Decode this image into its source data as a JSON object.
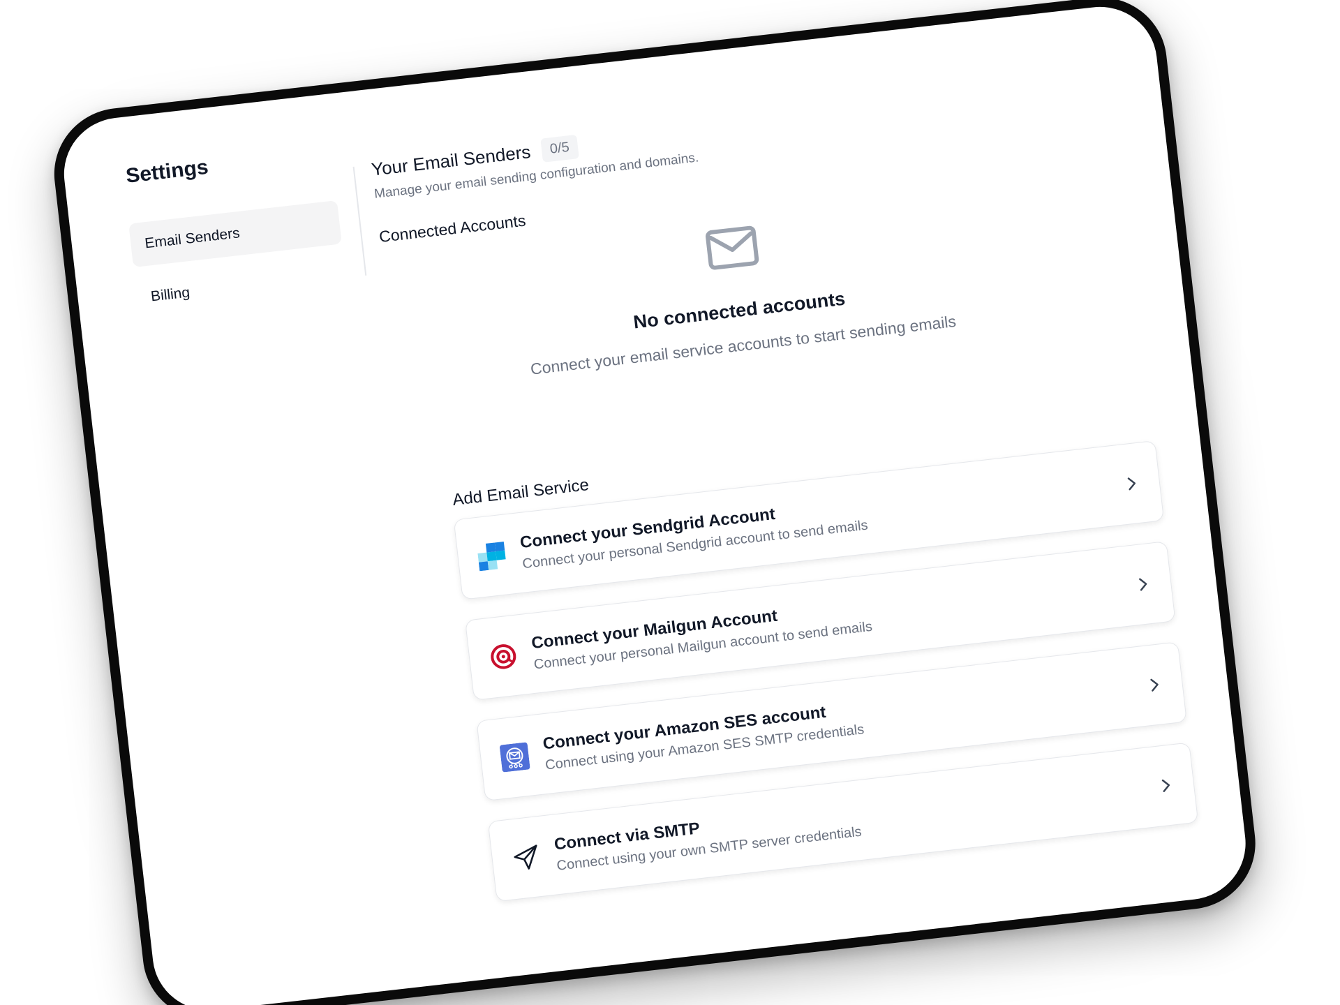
{
  "sidebar": {
    "title": "Settings",
    "items": [
      {
        "label": "Email Senders",
        "active": true
      },
      {
        "label": "Billing",
        "active": false
      }
    ]
  },
  "header": {
    "title": "Your Email Senders",
    "count": "0/5",
    "subtitle": "Manage your email sending configuration and domains."
  },
  "connected": {
    "title": "Connected Accounts",
    "empty_icon": "mail-icon",
    "empty_title": "No connected accounts",
    "empty_subtitle": "Connect your email service accounts to start sending emails"
  },
  "add_service": {
    "title": "Add Email Service",
    "services": [
      {
        "title": "Connect your Sendgrid Account",
        "description": "Connect your personal Sendgrid account to send emails",
        "icon": "sendgrid-icon"
      },
      {
        "title": "Connect your Mailgun Account",
        "description": "Connect your personal Mailgun account to send emails",
        "icon": "mailgun-icon"
      },
      {
        "title": "Connect your Amazon SES account",
        "description": "Connect using your Amazon SES SMTP credentials",
        "icon": "amazon-ses-icon"
      },
      {
        "title": "Connect via SMTP",
        "description": "Connect using your own SMTP server credentials",
        "icon": "paper-plane-icon"
      }
    ]
  },
  "colors": {
    "text_primary": "#111827",
    "text_muted": "#6b7280",
    "active_nav_bg": "#f4f4f5",
    "mailgun_red": "#c8102e",
    "ses_blue": "#4f6fd8"
  }
}
